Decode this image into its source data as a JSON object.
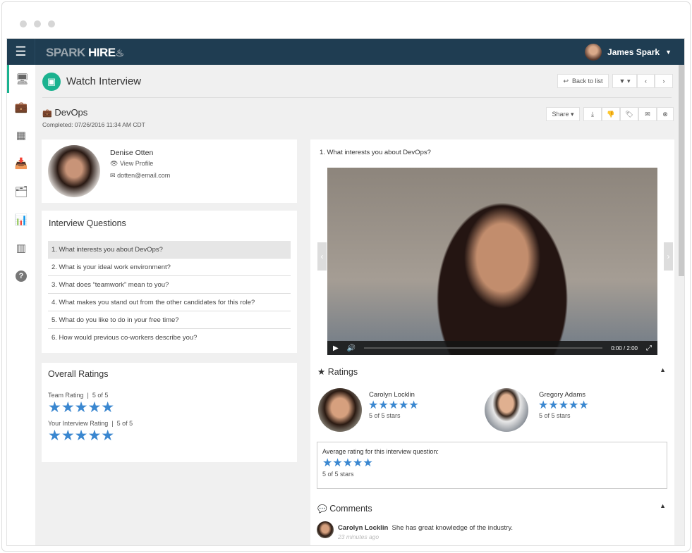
{
  "header": {
    "brand_a": "SPARK",
    "brand_b": "HIRE",
    "user_name": "James Spark"
  },
  "sidebar": [
    "monitor-icon",
    "briefcase-icon",
    "calendar-icon",
    "inbox-icon",
    "folders-icon",
    "chart-icon",
    "swatch-icon",
    "help-icon"
  ],
  "page": {
    "title": "Watch Interview",
    "back_label": "Back to list",
    "share_label": "Share"
  },
  "job": {
    "title": "DevOps",
    "completed": "Completed: 07/26/2016 11:34 AM CDT"
  },
  "candidate": {
    "name": "Denise Otten",
    "view_profile": "View Profile",
    "email": "dotten@email.com"
  },
  "questions": {
    "heading": "Interview Questions",
    "items": [
      "1. What interests you about DevOps?",
      "2. What is your ideal work environment?",
      "3. What does “teamwork” mean to  you?",
      "4. What makes you stand out from the other candidates for this role?",
      "5. What do you like to do in your free time?",
      "6. How would previous co-workers describe you?"
    ]
  },
  "overall": {
    "heading": "Overall Ratings",
    "team_label": "Team Rating",
    "team_value": "5 of 5",
    "your_label": "Your Interview Rating",
    "your_value": "5 of 5",
    "stars": "★★★★★"
  },
  "video": {
    "question": "1. What interests you about DevOps?",
    "time": "0:00 / 2:00",
    "progress": 0
  },
  "ratings": {
    "heading": "Ratings",
    "raters": [
      {
        "name": "Carolyn Locklin",
        "stars": "★★★★★",
        "text": "5 of 5 stars"
      },
      {
        "name": "Gregory Adams",
        "stars": "★★★★★",
        "text": "5 of 5 stars"
      }
    ],
    "avg_label": "Average rating for this interview question:",
    "avg_stars": "★★★★★",
    "avg_text": "5 of 5 stars"
  },
  "comments": {
    "heading": "Comments",
    "items": [
      {
        "author": "Carolyn Locklin",
        "text": "She has great knowledge of the industry.",
        "time": "23 minutes ago"
      }
    ]
  }
}
